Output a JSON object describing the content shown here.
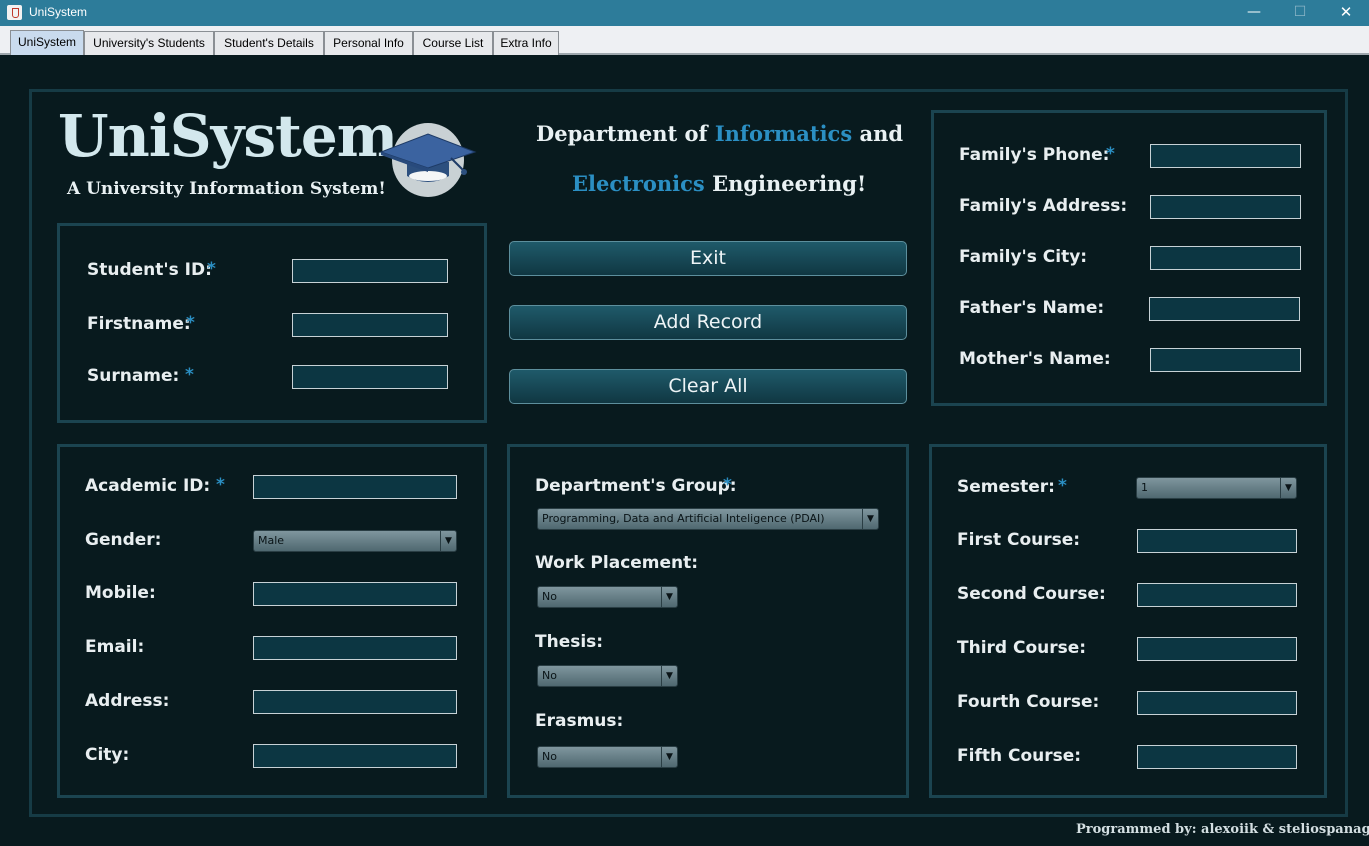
{
  "window": {
    "title": "UniSystem",
    "minimize_glyph": "—",
    "maximize_glyph": "☐",
    "close_glyph": "✕"
  },
  "tabs": [
    {
      "label": "UniSystem",
      "active": true
    },
    {
      "label": "University's Students"
    },
    {
      "label": "Student's Details"
    },
    {
      "label": "Personal Info"
    },
    {
      "label": "Course List"
    },
    {
      "label": "Extra Info"
    }
  ],
  "header": {
    "logo_title": "UniSystem",
    "logo_subtitle": "A University Information System!",
    "logo_icon": "graduation-cap-icon",
    "dept_line1_prefix": "Department of ",
    "dept_line1_accent": "Informatics",
    "dept_line1_suffix": " and",
    "dept_line2_accent": "Electronics",
    "dept_line2_suffix": " Engineering!"
  },
  "required_marker": "*",
  "identity": {
    "student_id_label": "Student's ID:",
    "firstname_label": "Firstname:",
    "surname_label": "Surname:",
    "student_id": "",
    "firstname": "",
    "surname": ""
  },
  "actions": {
    "exit": "Exit",
    "add_record": "Add Record",
    "clear_all": "Clear All"
  },
  "family": {
    "phone_label": "Family's Phone:",
    "address_label": "Family's Address:",
    "city_label": "Family's City:",
    "father_label": "Father's Name:",
    "mother_label": "Mother's Name:"
  },
  "personal": {
    "academic_id_label": "Academic ID:",
    "gender_label": "Gender:",
    "gender_value": "Male",
    "mobile_label": "Mobile:",
    "email_label": "Email:",
    "address_label": "Address:",
    "city_label": "City:"
  },
  "department": {
    "group_label": "Department's Group:",
    "group_value": "Programming, Data and Artificial Inteligence (PDAI)",
    "work_placement_label": "Work Placement:",
    "work_placement_value": "No",
    "thesis_label": "Thesis:",
    "thesis_value": "No",
    "erasmus_label": "Erasmus:",
    "erasmus_value": "No"
  },
  "courses": {
    "semester_label": "Semester:",
    "semester_value": "1",
    "first_label": "First Course:",
    "second_label": "Second Course:",
    "third_label": "Third Course:",
    "fourth_label": "Fourth Course:",
    "fifth_label": "Fifth Course:"
  },
  "footer": {
    "credits": "Programmed by: alexoiik & steliospanag"
  },
  "colors": {
    "titlebar": "#2d7c9a",
    "background": "#081a1e",
    "field": "#0c3642",
    "accent": "#2b8fc3",
    "panel_border": "#1b4450"
  }
}
